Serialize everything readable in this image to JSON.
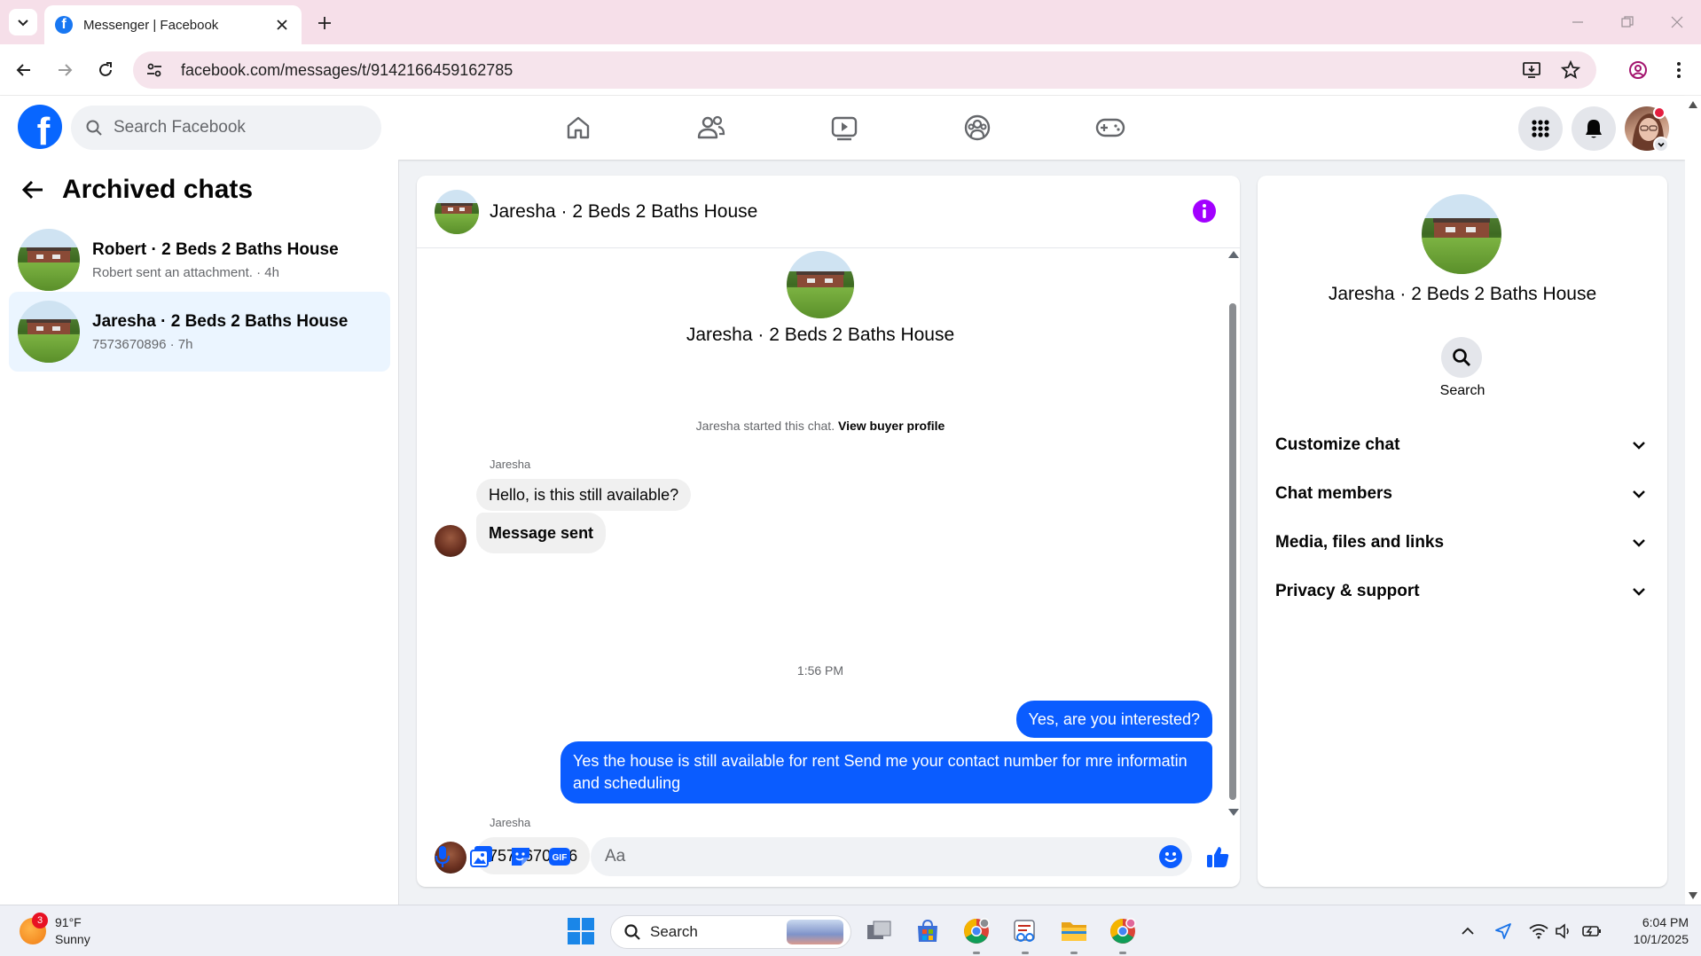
{
  "browser": {
    "tab_title": "Messenger | Facebook",
    "favicon_letter": "f",
    "url": "facebook.com/messages/t/9142166459162785"
  },
  "fb_header": {
    "logo_letter": "f",
    "search_placeholder": "Search Facebook"
  },
  "sidebar": {
    "title": "Archived chats",
    "conversations": [
      {
        "name": "Robert · 2 Beds 2 Baths House",
        "preview": "Robert sent an attachment. · 4h",
        "active": false
      },
      {
        "name": "Jaresha · 2 Beds 2 Baths House",
        "preview": "7573670896 · 7h",
        "active": true
      }
    ]
  },
  "chat": {
    "title": "Jaresha · 2 Beds 2 Baths House",
    "hero_name": "Jaresha · 2 Beds 2 Baths House",
    "started_text": "Jaresha started this chat.",
    "started_link": "View buyer profile",
    "messages": [
      {
        "sender": "Jaresha",
        "text": "Hello, is this still available?",
        "direction": "in"
      },
      {
        "text": "Message sent",
        "direction": "in"
      },
      {
        "text": "Yes, are you interested?",
        "direction": "out"
      },
      {
        "text": "Yes the house is still available for rent Send me your contact number for mre informatin and  scheduling",
        "direction": "out"
      },
      {
        "sender": "Jaresha",
        "text": "7573670896",
        "direction": "in"
      }
    ],
    "timestamp": "1:56 PM",
    "composer_placeholder": "Aa",
    "colors": {
      "outgoing": "#0a5cff",
      "incoming": "#f0f0f0",
      "accent": "#a200ff"
    }
  },
  "details": {
    "name": "Jaresha · 2 Beds 2 Baths House",
    "search_label": "Search",
    "sections": [
      "Customize chat",
      "Chat members",
      "Media, files and links",
      "Privacy & support"
    ]
  },
  "taskbar": {
    "weather_badge": "3",
    "temperature": "91°F",
    "condition": "Sunny",
    "search_placeholder": "Search",
    "time": "6:04 PM",
    "date": "10/1/2025"
  }
}
